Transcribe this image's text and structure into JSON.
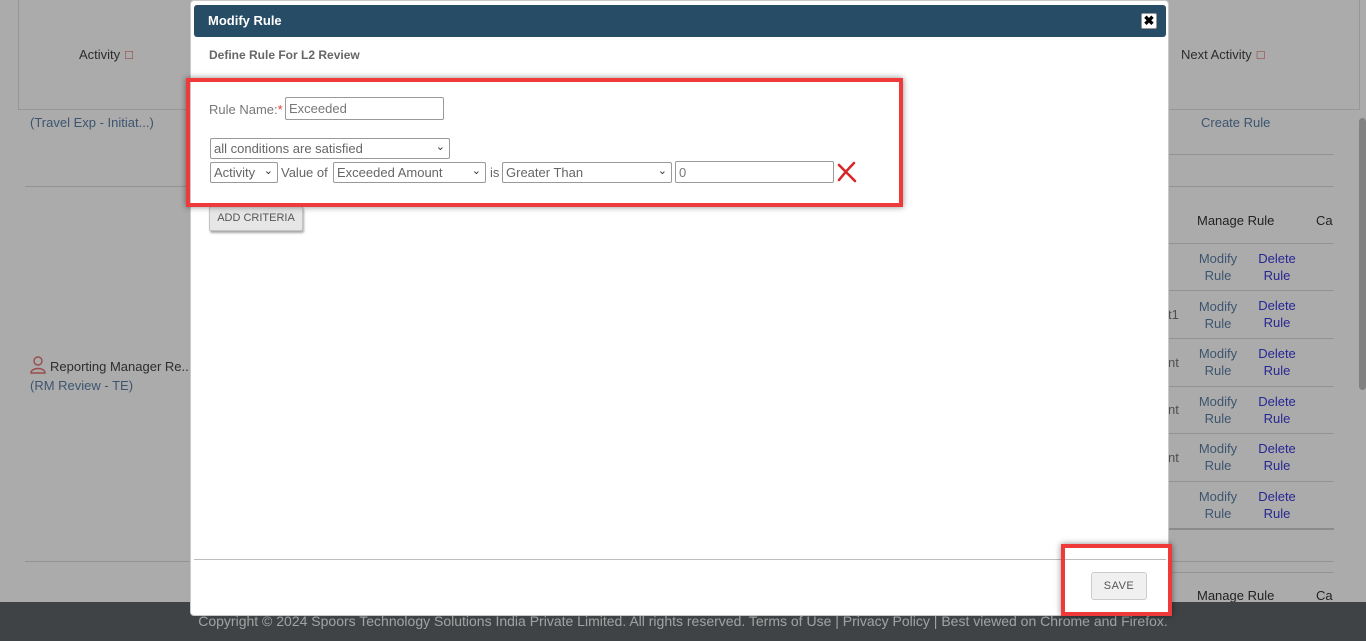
{
  "background": {
    "header_activity": "Activity",
    "header_next_activity": "Next Activity",
    "row1_link": "(Travel Exp - Initiat...)",
    "create_rule": "Create Rule",
    "manage_rule_header": "Manage Rule",
    "ca_header": "Ca",
    "reporting_manager": "Reporting Manager Re...",
    "rm_review": "(RM Review - TE)",
    "modify_label_1": "Modify",
    "modify_label_2": "Rule",
    "delete_label_1": "Delete",
    "delete_label_2": "Rule",
    "partial_texts": [
      "t1",
      "nt",
      "nt",
      "nt"
    ]
  },
  "modal": {
    "title": "Modify Rule",
    "close_icon": "close-icon",
    "subtitle": "Define Rule For L2 Review",
    "rule_name_label": "Rule Name:",
    "required_marker": "*",
    "rule_name_value": "Exceeded",
    "condition_mode": "all conditions are satisfied",
    "criteria": {
      "source": "Activity",
      "value_of_text": "Value of",
      "field": "Exceeded Amount",
      "is_text": "is",
      "operator": "Greater Than",
      "value": "0"
    },
    "add_criteria_label": "ADD CRITERIA",
    "save_label": "SAVE"
  },
  "footer": {
    "text": "Copyright © 2024 Spoors Technology Solutions India Private Limited. All rights reserved. Terms of Use | Privacy Policy | Best viewed on Chrome and Firefox."
  },
  "colors": {
    "modal_header": "#264c66",
    "highlight": "#ee3a3a",
    "footer": "#5e6468",
    "link_blue": "#5b7fa6",
    "link_purple": "#3b3bdc"
  }
}
